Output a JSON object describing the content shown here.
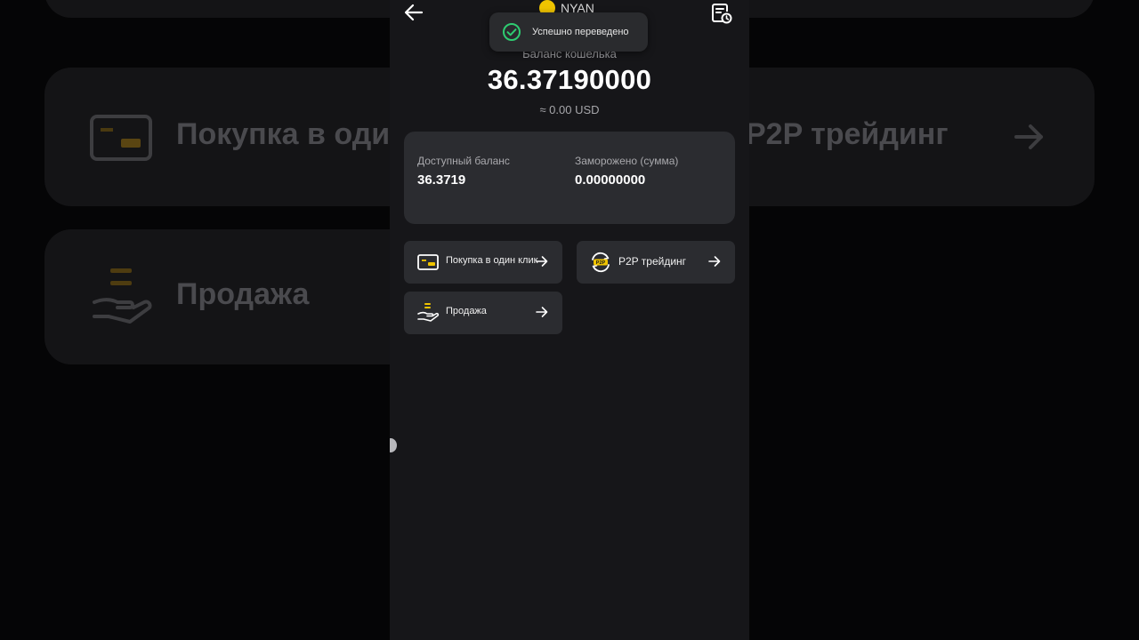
{
  "app": {
    "logo_text": "NYAN",
    "brand_color": "#f0c400"
  },
  "toast": {
    "message": "Успешно переведено",
    "icon": "check-circle-icon",
    "color": "#2ecc71"
  },
  "wallet": {
    "label": "Баланс кошелька",
    "amount": "36.37190000",
    "usd": "≈ 0.00 USD"
  },
  "balances": {
    "available_label": "Доступный баланс",
    "available_value": "36.3719",
    "frozen_label": "Заморожено (сумма)",
    "frozen_value": "0.00000000"
  },
  "actions": {
    "buy_label": "Покупка в один клик",
    "p2p_label": "P2P трейдинг",
    "sell_label": "Продажа"
  },
  "background": {
    "buy_label": "Покупка в один",
    "p2p_label": "P2P трейдинг",
    "sell_label": "Продажа"
  },
  "icons": {
    "back": "arrow-left-icon",
    "history": "order-history-icon",
    "buy": "card-icon",
    "p2p": "p2p-icon",
    "sell": "hand-coins-icon",
    "arrow": "arrow-right-icon"
  }
}
